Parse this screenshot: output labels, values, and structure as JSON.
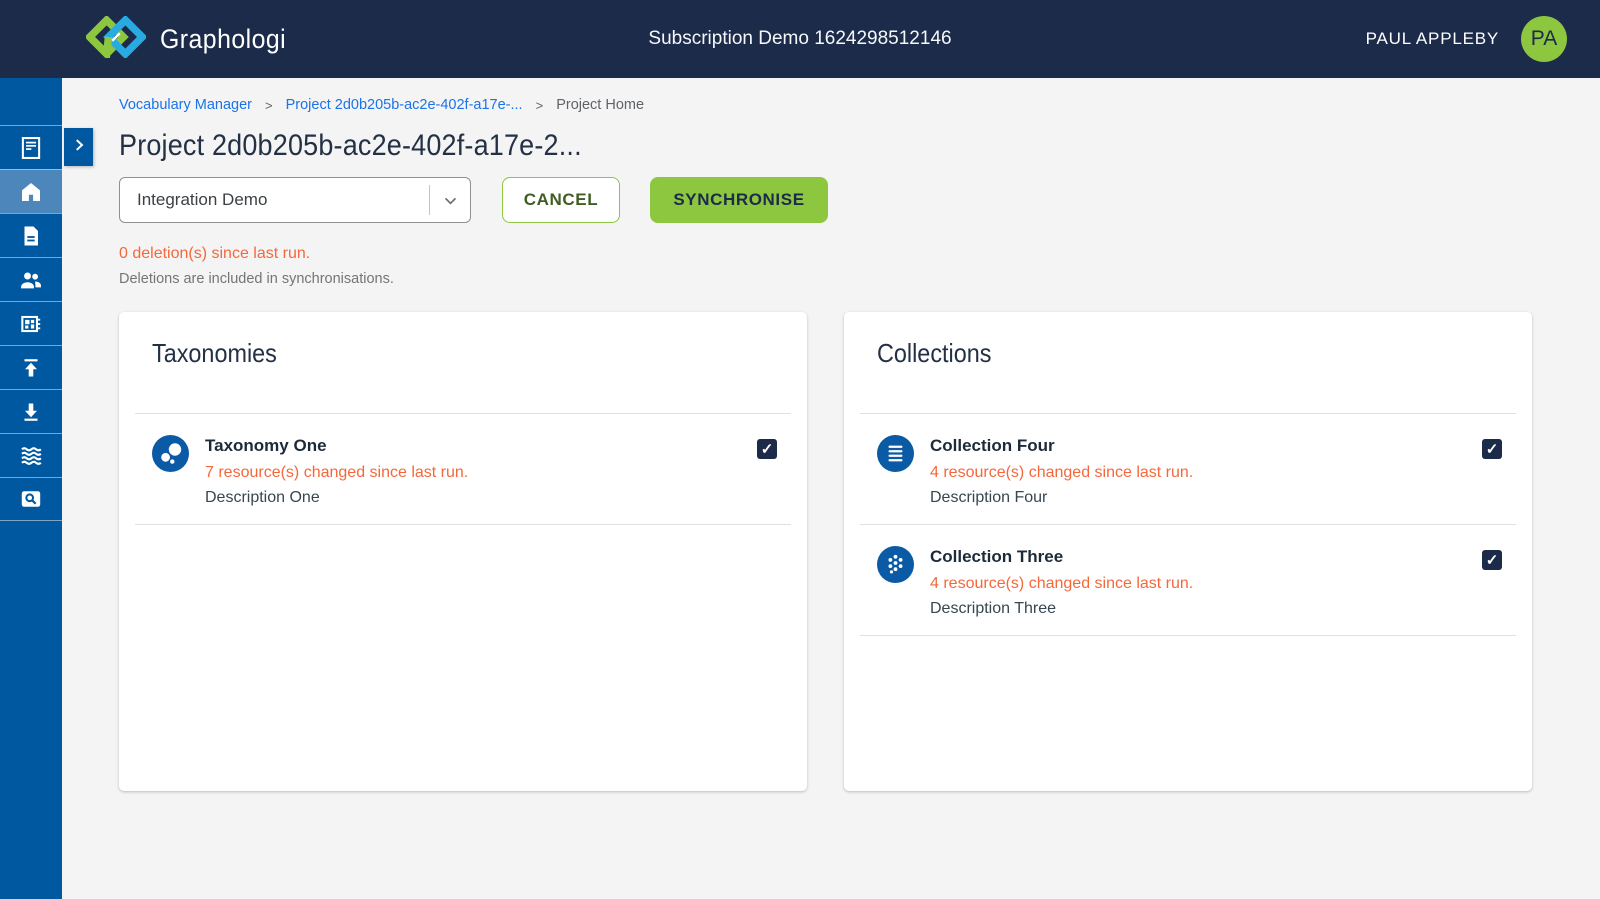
{
  "topbar": {
    "brand": "Graphologi",
    "title": "Subscription Demo 1624298512146",
    "user_name": "PAUL APPLEBY",
    "user_initials": "PA"
  },
  "sidebar": {
    "items": [
      "journal-icon",
      "home-icon",
      "document-icon",
      "people-icon",
      "board-icon",
      "upload-icon",
      "download-icon",
      "waves-icon",
      "search-icon"
    ],
    "active_item": "home-icon",
    "expand_icon": "chevron-right-icon"
  },
  "breadcrumb": {
    "separator": ">",
    "items": [
      {
        "label": "Vocabulary Manager",
        "link": true
      },
      {
        "label": "Project 2d0b205b-ac2e-402f-a17e-...",
        "link": true
      },
      {
        "label": "Project Home",
        "link": false
      }
    ]
  },
  "page": {
    "title": "Project 2d0b205b-ac2e-402f-a17e-2...",
    "project_select_value": "Integration Demo",
    "cancel_label": "CANCEL",
    "synchronise_label": "SYNCHRONISE",
    "deletions_notice": "0 deletion(s) since last run.",
    "deletions_subtext": "Deletions are included in synchronisations."
  },
  "panels": [
    {
      "title": "Taxonomies",
      "items": [
        {
          "icon": "bubbles-icon",
          "name": "Taxonomy One",
          "status": "7 resource(s) changed since last run.",
          "description": "Description One",
          "checked": true
        }
      ]
    },
    {
      "title": "Collections",
      "items": [
        {
          "icon": "lines-icon",
          "name": "Collection Four",
          "status": "4 resource(s) changed since last run.",
          "description": "Description Four",
          "checked": true
        },
        {
          "icon": "dots-icon",
          "name": "Collection Three",
          "status": "4 resource(s) changed since last run.",
          "description": "Description Three",
          "checked": true
        }
      ]
    }
  ],
  "colors": {
    "topbar_navy": "#1c2b4a",
    "sidebar_blue": "#0058a0",
    "sidebar_active_blue": "#4d86ba",
    "accent_green": "#8dc63f",
    "logo_blue": "#29abe2",
    "status_orange": "#f4683c",
    "link_blue": "#1a73e8",
    "entry_icon_blue": "#0b5aa5",
    "checkbox_navy": "#1c2b4a"
  }
}
